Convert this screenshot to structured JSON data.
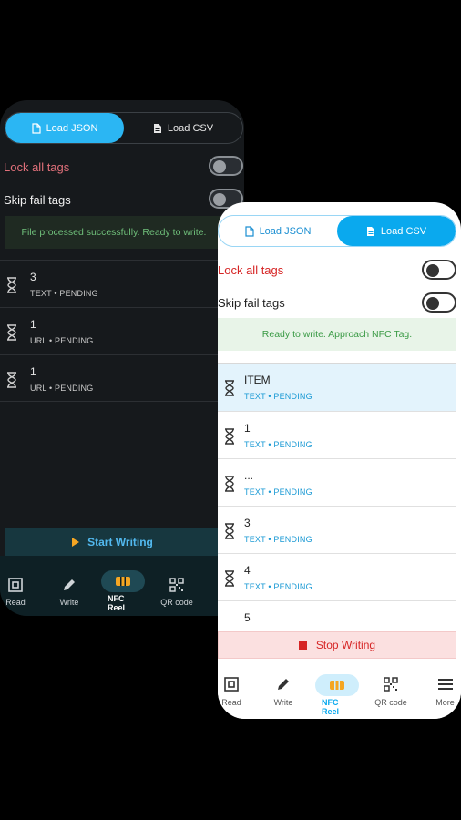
{
  "dark_screen": {
    "tabs": [
      {
        "label": "Load JSON",
        "icon": "file-icon",
        "active": true
      },
      {
        "label": "Load CSV",
        "icon": "csv-file-icon",
        "active": false
      }
    ],
    "lock_all_tags_label": "Lock all tags",
    "skip_fail_tags_label": "Skip fail tags",
    "status_message": "File processed successfully. Ready to write.",
    "items": [
      {
        "title": "3",
        "subtitle": "TEXT • PENDING"
      },
      {
        "title": "1",
        "subtitle": "URL • PENDING"
      },
      {
        "title": "1",
        "subtitle": "URL • PENDING"
      }
    ],
    "action_label": "Start Writing",
    "nav": [
      {
        "label": "Read",
        "icon": "nfc-read-icon"
      },
      {
        "label": "Write",
        "icon": "pencil-icon"
      },
      {
        "label": "NFC Reel",
        "icon": "nfc-reel-icon",
        "active": true
      },
      {
        "label": "QR code",
        "icon": "qr-code-icon"
      }
    ],
    "colors": {
      "accent": "#2bb6f3",
      "lock_label": "#e0707a",
      "start": "#52b9ef"
    }
  },
  "light_screen": {
    "tabs": [
      {
        "label": "Load JSON",
        "icon": "file-icon",
        "active": false
      },
      {
        "label": "Load CSV",
        "icon": "csv-file-icon",
        "active": true
      }
    ],
    "lock_all_tags_label": "Lock all tags",
    "skip_fail_tags_label": "Skip fail tags",
    "status_message": "Ready to write. Approach NFC Tag.",
    "items": [
      {
        "title": "ITEM",
        "subtitle": "TEXT • PENDING",
        "highlighted": true
      },
      {
        "title": "1",
        "subtitle": "TEXT • PENDING"
      },
      {
        "title": "...",
        "subtitle": "TEXT • PENDING"
      },
      {
        "title": "3",
        "subtitle": "TEXT • PENDING"
      },
      {
        "title": "4",
        "subtitle": "TEXT • PENDING"
      },
      {
        "title": "5",
        "subtitle": ""
      }
    ],
    "action_label": "Stop Writing",
    "nav": [
      {
        "label": "Read",
        "icon": "nfc-read-icon"
      },
      {
        "label": "Write",
        "icon": "pencil-icon"
      },
      {
        "label": "NFC Reel",
        "icon": "nfc-reel-icon",
        "active": true
      },
      {
        "label": "QR code",
        "icon": "qr-code-icon"
      },
      {
        "label": "More",
        "icon": "menu-icon"
      }
    ],
    "colors": {
      "accent": "#0aa9ee",
      "lock_label": "#d62424",
      "stop": "#d62424",
      "highlight": "#e3f3fc"
    }
  }
}
